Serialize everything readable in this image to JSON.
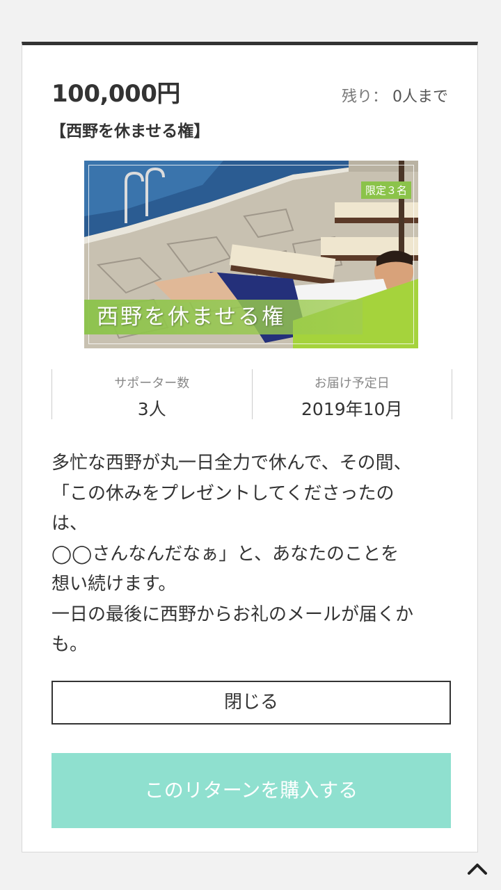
{
  "reward": {
    "price": "100,000円",
    "remaining_label": "残り：",
    "remaining_value": "0人まで",
    "title": "【西野を休ませる権】",
    "image": {
      "badge": "限定３名",
      "caption": "西野を休ませる権"
    },
    "stats": [
      {
        "label": "サポーター数",
        "value": "3人"
      },
      {
        "label": "お届け予定日",
        "value": "2019年10月"
      }
    ],
    "description_lines": [
      "多忙な西野が丸一日全力で休んで、その間、",
      "「この休みをプレゼントしてくださったの",
      "は、",
      "◯◯さんなんだなぁ」と、あなたのことを",
      "想い続けます。",
      "一日の最後に西野からお礼のメールが届くか",
      "も。"
    ]
  },
  "buttons": {
    "close_label": "閉じる",
    "buy_label": "このリターンを購入する"
  },
  "icons": {
    "scroll_top": "chevron-up-icon"
  },
  "colors": {
    "accent_border": "#333333",
    "buy_button": "#8fe0cf",
    "badge": "#8bc34a"
  }
}
